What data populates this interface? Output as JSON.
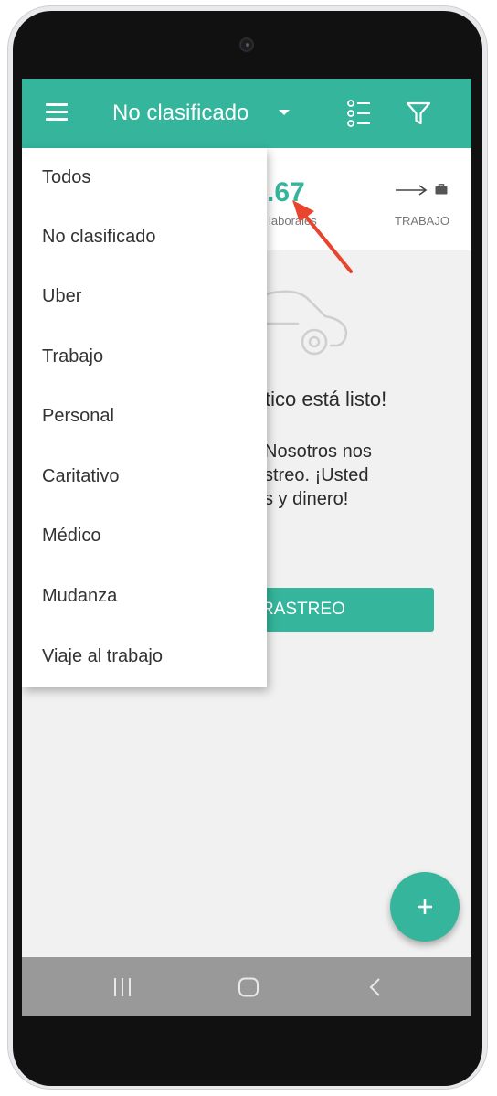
{
  "colors": {
    "accent": "#35b59b",
    "annotation": "#e8442e"
  },
  "header": {
    "title": "No clasificado",
    "menu_icon": "hamburger-icon",
    "dropdown_icon": "caret-down-icon",
    "list_icon": "list-icon",
    "filter_icon": "filter-icon"
  },
  "stats": {
    "value": ".67",
    "value_label": "laborales",
    "trip_label": "TRABAJO",
    "arrow_icon": "arrow-right-icon",
    "briefcase_icon": "briefcase-icon"
  },
  "empty_state": {
    "icon": "car-icon",
    "title": "tico está listo!",
    "body_lines": [
      "Nosotros nos",
      "streo. ¡Usted",
      "s y dinero!"
    ],
    "button_label": "RASTREO"
  },
  "fab": {
    "icon": "plus-icon"
  },
  "dropdown_menu": {
    "items": [
      "Todos",
      "No clasificado",
      "Uber",
      "Trabajo",
      "Personal",
      "Caritativo",
      "Médico",
      "Mudanza",
      "Viaje al trabajo"
    ]
  },
  "nav": {
    "recents_icon": "recents-icon",
    "home_icon": "home-icon",
    "back_icon": "back-icon"
  }
}
